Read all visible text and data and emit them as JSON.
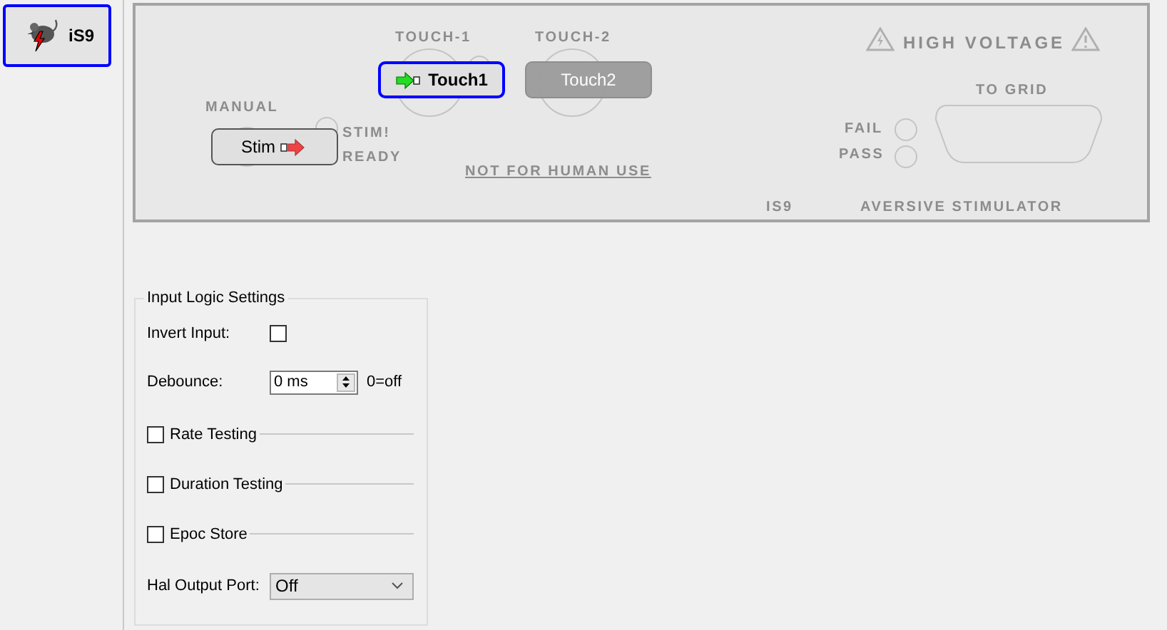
{
  "devices": [
    {
      "label": "iS9",
      "selected": true
    }
  ],
  "faceplate": {
    "manual_label": "MANUAL",
    "stim_label": "STIM!",
    "ready_label": "READY",
    "touch1_label": "TOUCH-1",
    "touch2_label": "TOUCH-2",
    "warning": "HIGH VOLTAGE",
    "grid_label": "TO GRID",
    "fail_label": "FAIL",
    "pass_label": "PASS",
    "notice": "NOT FOR HUMAN USE",
    "model": "IS9",
    "product": "AVERSIVE STIMULATOR",
    "buttons": [
      {
        "kind": "stim",
        "label": "Stim",
        "selected": false,
        "disabled": false
      },
      {
        "kind": "touch1",
        "label": "Touch1",
        "selected": true,
        "disabled": false
      },
      {
        "kind": "touch2",
        "label": "Touch2",
        "selected": false,
        "disabled": true
      }
    ]
  },
  "settings": {
    "title": "Input Logic Settings",
    "invert_label": "Invert Input:",
    "invert_checked": false,
    "debounce_label": "Debounce:",
    "debounce_value": "0 ms",
    "debounce_hint": "0=off",
    "sections": [
      {
        "label": "Rate Testing",
        "checked": false
      },
      {
        "label": "Duration Testing",
        "checked": false
      },
      {
        "label": "Epoc Store",
        "checked": false
      }
    ],
    "output_label": "Hal Output Port:",
    "output_value": "Off"
  }
}
